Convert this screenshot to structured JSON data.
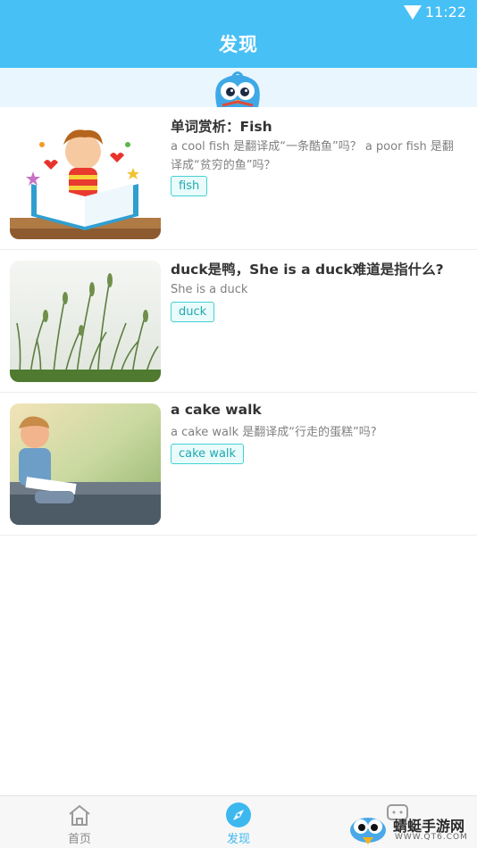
{
  "status": {
    "time": "11:22"
  },
  "header": {
    "title": "发现"
  },
  "articles": [
    {
      "title": "单词赏析：Fish",
      "desc": "a cool fish 是翻译成“一条酷鱼”吗？  a poor fish 是翻译成“贫穷的鱼”吗？",
      "tag": "fish"
    },
    {
      "title": "duck是鸭，She is a duck难道是指什么?",
      "desc": "She is a duck",
      "tag": "duck"
    },
    {
      "title": "a cake walk",
      "desc": "a cake walk 是翻译成“行走的蛋糕”吗?",
      "tag": "cake walk"
    }
  ],
  "bottom_nav": {
    "items": [
      {
        "label": "首页"
      },
      {
        "label": "发现"
      }
    ],
    "active_color": "#3cb8ef",
    "inactive_color": "#8a8a8a"
  },
  "watermark": {
    "text": "蜻蜓手游网",
    "sub": "WWW.QT6.COM"
  }
}
